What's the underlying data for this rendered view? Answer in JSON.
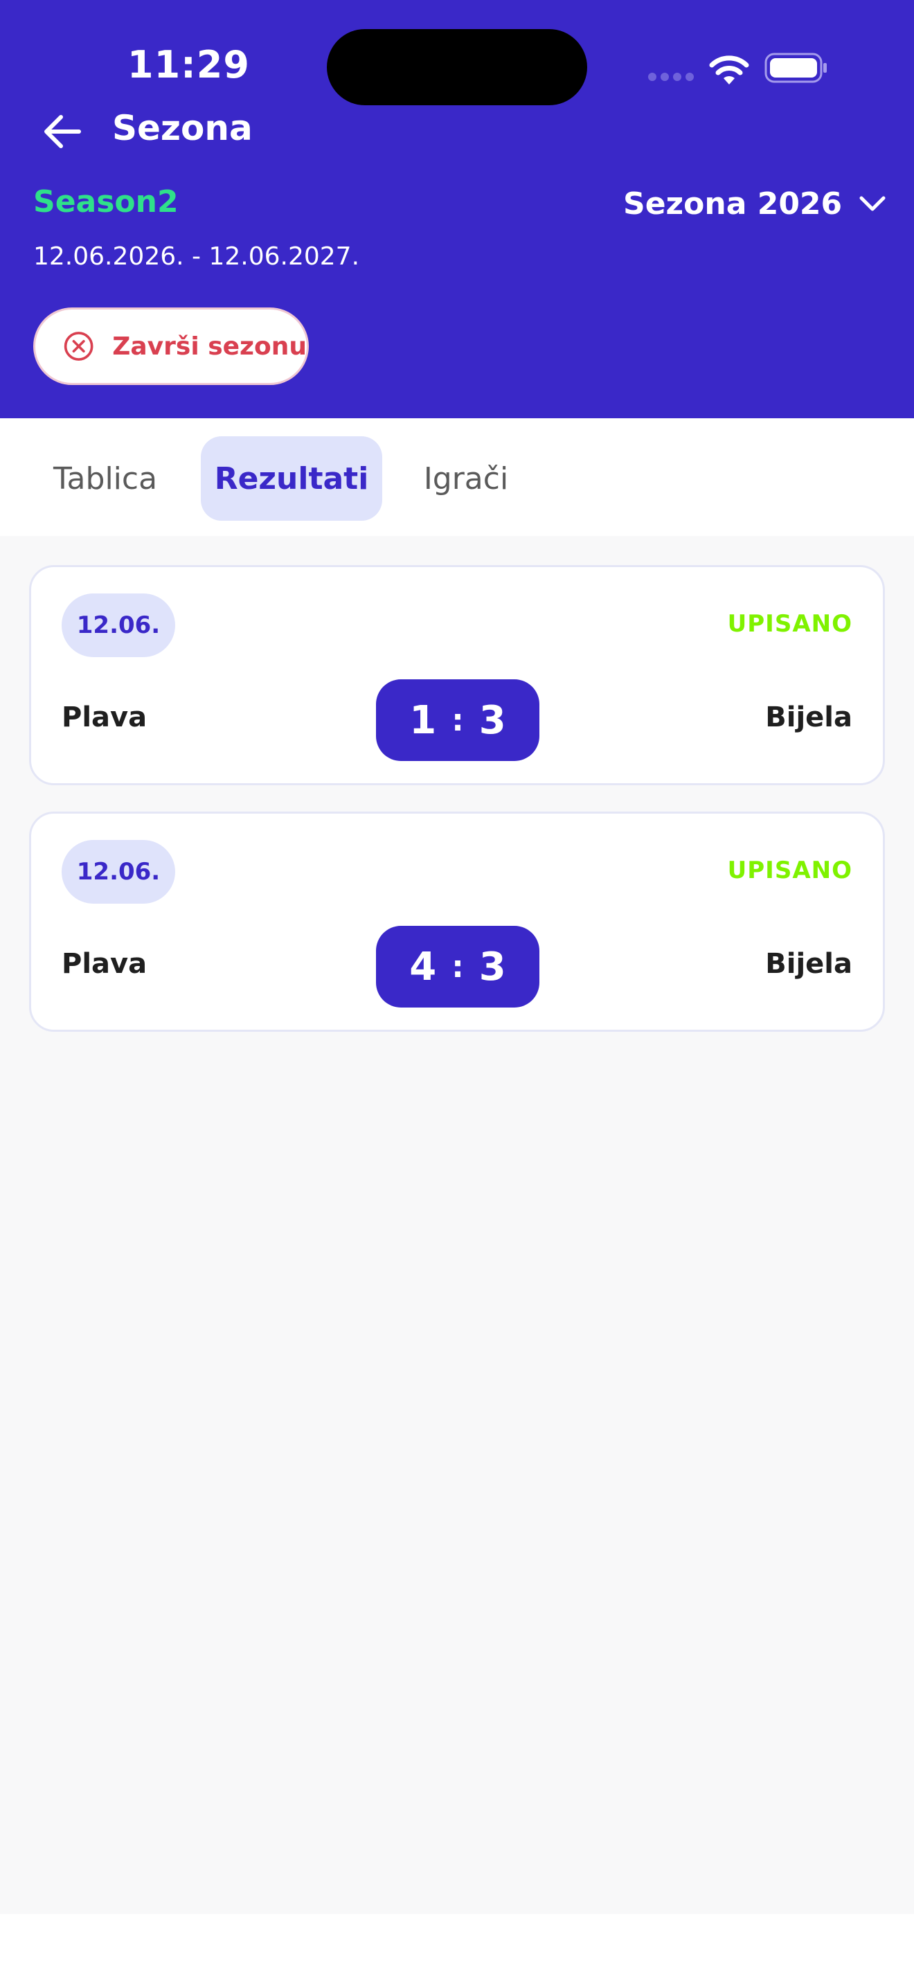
{
  "status": {
    "time": "11:29",
    "signal_icon": "cellular-signal-icon",
    "wifi_icon": "wifi-icon",
    "battery_icon": "battery-icon"
  },
  "header": {
    "back_icon": "arrow-left-icon",
    "title": "Sezona",
    "season_name": "Season2",
    "season_select_label": "Sezona 2026",
    "season_select_icon": "chevron-down-icon",
    "date_range": "12.06.2026. - 12.06.2027.",
    "end_season_label": "Završi sezonu",
    "end_season_icon": "close-circle-icon"
  },
  "tabs": [
    {
      "label": "Tablica",
      "active": false
    },
    {
      "label": "Rezultati",
      "active": true
    },
    {
      "label": "Igrači",
      "active": false
    }
  ],
  "matches": [
    {
      "date": "12.06.",
      "status": "UPISANO",
      "home": "Plava",
      "away": "Bijela",
      "home_score": "1",
      "away_score": "3",
      "separator": ":"
    },
    {
      "date": "12.06.",
      "status": "UPISANO",
      "home": "Plava",
      "away": "Bijela",
      "home_score": "4",
      "away_score": "3",
      "separator": ":"
    }
  ],
  "colors": {
    "brand": "#3a28c8",
    "season_name": "#2fe08a",
    "status_ok": "#7ff200",
    "danger": "#d94050",
    "tab_active_bg": "#dfe3fb"
  }
}
